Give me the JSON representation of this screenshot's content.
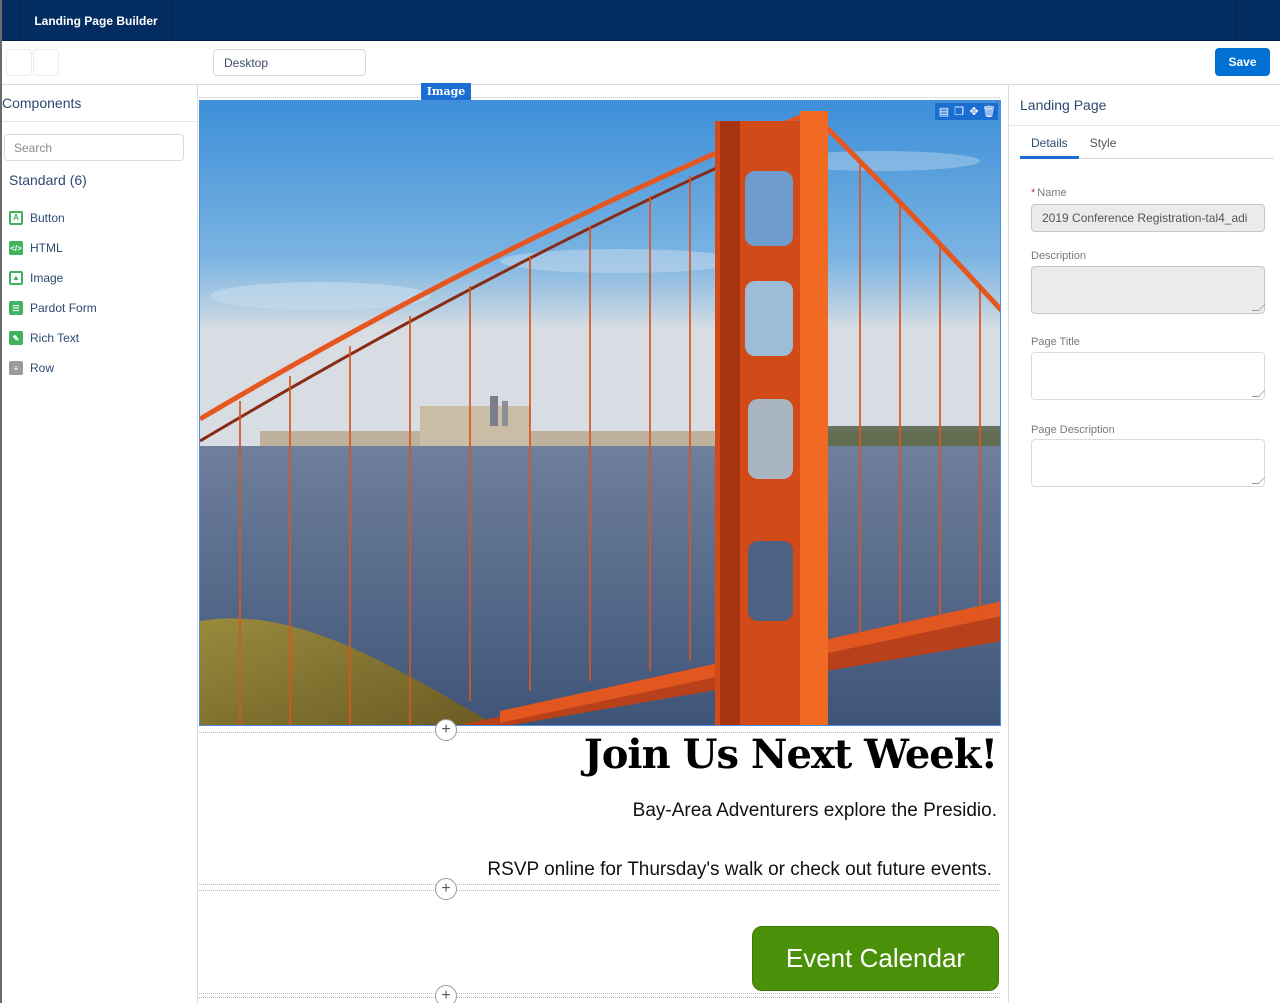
{
  "topbar": {
    "app_title": "Landing Page Builder"
  },
  "toolbar": {
    "device": "Desktop",
    "save_label": "Save"
  },
  "sidebar": {
    "title": "Components",
    "search_placeholder": "Search",
    "group_label": "Standard (6)",
    "items": [
      {
        "label": "Button",
        "icon": "button-icon"
      },
      {
        "label": "HTML",
        "icon": "code-icon"
      },
      {
        "label": "Image",
        "icon": "image-icon"
      },
      {
        "label": "Pardot Form",
        "icon": "form-icon"
      },
      {
        "label": "Rich Text",
        "icon": "pencil-icon"
      },
      {
        "label": "Row",
        "icon": "row-icon"
      }
    ]
  },
  "canvas": {
    "selected_label": "Image",
    "image_tools": [
      "layout-icon",
      "duplicate-icon",
      "move-icon",
      "delete-icon"
    ],
    "image_alt": "Golden Gate Bridge with San Francisco skyline",
    "headline": "Join Us Next Week!",
    "subtext1": "Bay-Area Adventurers explore the Presidio.",
    "subtext2": "RSVP online for Thursday's walk or check out future events.",
    "cta_label": "Event Calendar",
    "add_symbol": "+"
  },
  "rpanel": {
    "title": "Landing Page",
    "tabs": [
      {
        "label": "Details",
        "active": true
      },
      {
        "label": "Style",
        "active": false
      }
    ],
    "fields": {
      "name_label": "Name",
      "name_required": "*",
      "name_value": "2019 Conference Registration-tal4_adi",
      "description_label": "Description",
      "page_title_label": "Page Title",
      "page_description_label": "Page Description"
    }
  },
  "colors": {
    "nav": "#032d60",
    "brand": "#0070d2",
    "cta": "#4a9008",
    "component_icon": "#3fb45c"
  }
}
